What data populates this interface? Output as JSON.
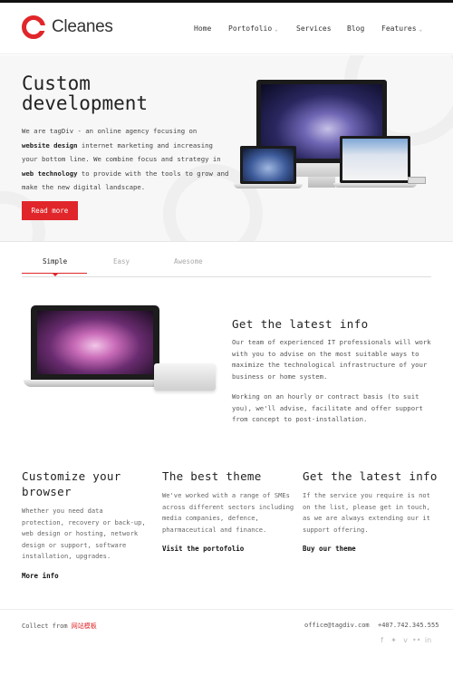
{
  "brand": {
    "name": "Cleanes",
    "accent": "#e0262a"
  },
  "nav": [
    {
      "label": "Home",
      "caret": false
    },
    {
      "label": "Portofolio",
      "caret": true
    },
    {
      "label": "Services",
      "caret": false
    },
    {
      "label": "Blog",
      "caret": false
    },
    {
      "label": "Features",
      "caret": true
    }
  ],
  "hero": {
    "title_line1": "Custom",
    "title_line2": "development",
    "text": {
      "p1": "We are tagDiv - an online agency focusing on",
      "b1": "website design",
      "p2": " internet marketing and increasing your bottom line. We combine focus and strategy in ",
      "b2": "web technology",
      "p3": " to provide with the tools to grow and make the new digital landscape."
    },
    "button": "Read more"
  },
  "tabs": [
    {
      "label": "Simple",
      "active": true
    },
    {
      "label": "Easy",
      "active": false
    },
    {
      "label": "Awesome",
      "active": false
    }
  ],
  "info": {
    "title": "Get the latest info",
    "p1": "Our team of experienced IT professionals will work with you to advise on the most suitable ways to maximize the technological infrastructure of your business or home system.",
    "p2": "Working on an hourly or contract basis (to suit you), we'll advise, facilitate and offer support from concept to post-installation."
  },
  "columns": [
    {
      "title": "Customize your browser",
      "text": "Whether you need data protection, recovery or back-up, web design or hosting, network design or support, software installation, upgrades.",
      "link": "More info"
    },
    {
      "title": "The best theme",
      "text": "We've worked with a range of SMEs across different sectors including media companies, defence, pharmaceutical and finance.",
      "link": "Visit the portofolio"
    },
    {
      "title": "Get the latest info",
      "text": "If the service you require is not on the list, please get in touch, as we are always extending our it support offering.",
      "link": "Buy our theme"
    }
  ],
  "footer": {
    "collect_prefix": "Collect from ",
    "collect_link": "网站模板",
    "email": "office@tagdiv.com",
    "phone": "+407.742.345.555",
    "social_icons": [
      "facebook-icon",
      "twitter-icon",
      "vimeo-icon",
      "flickr-icon",
      "linkedin-icon"
    ]
  }
}
